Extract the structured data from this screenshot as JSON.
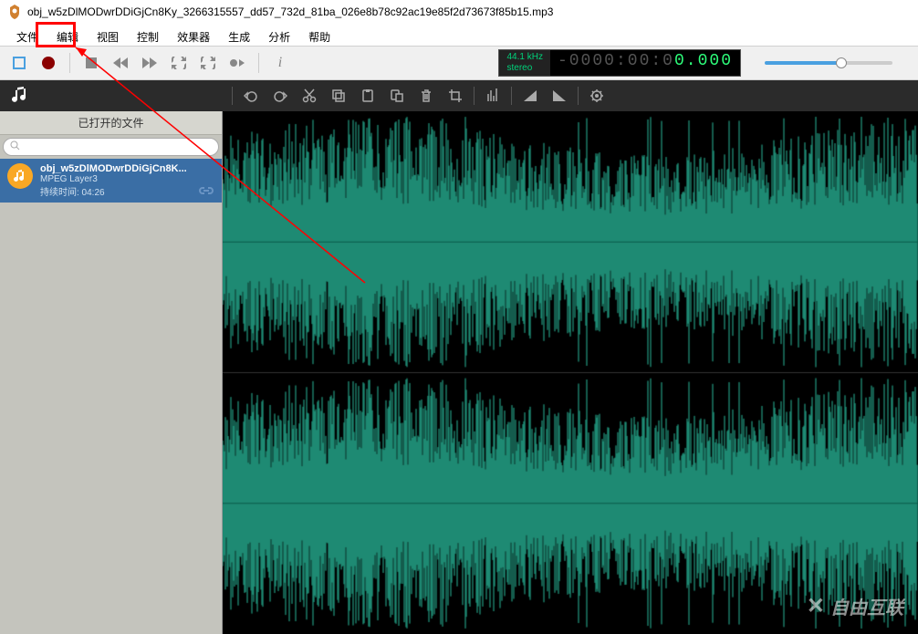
{
  "title": "obj_w5zDlMODwrDDiGjCn8Ky_3266315557_dd57_732d_81ba_026e8b78c92ac19e85f2d73673f85b15.mp3",
  "menu": {
    "file": "文件",
    "edit": "编辑",
    "view": "视图",
    "control": "控制",
    "effects": "效果器",
    "generate": "生成",
    "analyze": "分析",
    "help": "帮助"
  },
  "time": {
    "sample_rate": "44.1 kHz",
    "channel_mode": "stereo",
    "dimmed": "-0000:00:0",
    "active": "0.000"
  },
  "sidebar": {
    "header": "已打开的文件",
    "search_placeholder": "",
    "file": {
      "name": "obj_w5zDlMODwrDDiGjCn8K...",
      "format": "MPEG Layer3",
      "duration_label": "持续时间: 04:26"
    }
  },
  "watermark": "自由互联",
  "colors": {
    "waveform": "#28b99a",
    "waveform_bg": "#000000",
    "highlight": "#ff0000",
    "selection": "#3a6ea5"
  }
}
